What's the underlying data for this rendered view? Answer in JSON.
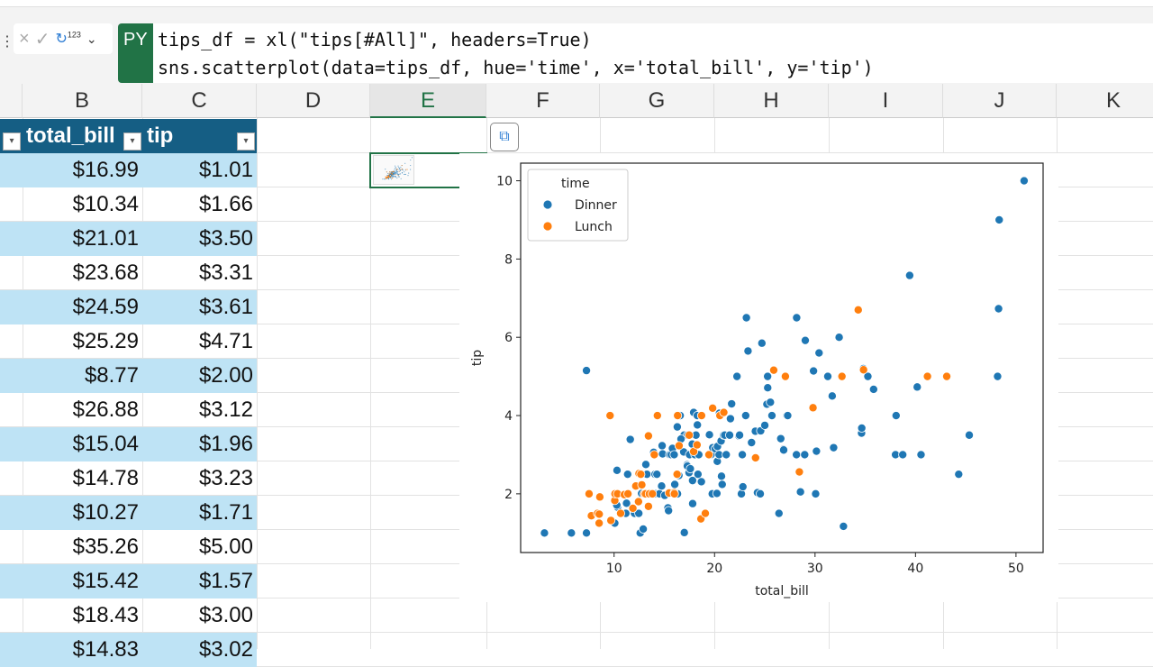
{
  "formula_bar": {
    "cancel_icon": "×",
    "enter_icon": "✓",
    "output_type_label": "123",
    "py_badge": "PY",
    "line1": "tips_df = xl(\"tips[#All]\", headers=True)",
    "line2": "sns.scatterplot(data=tips_df, hue='time', x='total_bill', y='tip')"
  },
  "columns": [
    "B",
    "C",
    "D",
    "E",
    "F",
    "G",
    "H",
    "I",
    "J",
    "K"
  ],
  "table": {
    "headers": [
      "total_bill",
      "tip"
    ],
    "rows": [
      [
        "$16.99",
        "$1.01"
      ],
      [
        "$10.34",
        "$1.66"
      ],
      [
        "$21.01",
        "$3.50"
      ],
      [
        "$23.68",
        "$3.31"
      ],
      [
        "$24.59",
        "$3.61"
      ],
      [
        "$25.29",
        "$4.71"
      ],
      [
        "$8.77",
        "$2.00"
      ],
      [
        "$26.88",
        "$3.12"
      ],
      [
        "$15.04",
        "$1.96"
      ],
      [
        "$14.78",
        "$3.23"
      ],
      [
        "$10.27",
        "$1.71"
      ],
      [
        "$35.26",
        "$5.00"
      ],
      [
        "$15.42",
        "$1.57"
      ],
      [
        "$18.43",
        "$3.00"
      ],
      [
        "$14.83",
        "$3.02"
      ]
    ]
  },
  "chart_data": {
    "type": "scatter",
    "xlabel": "total_bill",
    "ylabel": "tip",
    "xticks": [
      10,
      20,
      30,
      40,
      50
    ],
    "yticks": [
      2,
      4,
      6,
      8,
      10
    ],
    "xlim": [
      0.7,
      52.7
    ],
    "ylim": [
      0.5,
      10.45
    ],
    "legend": {
      "title": "time",
      "placement": "top-left"
    },
    "series": [
      {
        "name": "Dinner",
        "color": "#1f77b4",
        "points": [
          [
            3.07,
            1
          ],
          [
            5.75,
            1
          ],
          [
            7.25,
            1
          ],
          [
            7.25,
            5.15
          ],
          [
            9.55,
            4
          ],
          [
            10.07,
            1.25
          ],
          [
            10.29,
            2.6
          ],
          [
            10.33,
            1.67
          ],
          [
            10.34,
            1.66
          ],
          [
            10.27,
            1.71
          ],
          [
            11.17,
            1.5
          ],
          [
            11.24,
            1.76
          ],
          [
            11.35,
            2.5
          ],
          [
            11.61,
            3.39
          ],
          [
            12.03,
            1.5
          ],
          [
            12.46,
            1.5
          ],
          [
            12.54,
            2.5
          ],
          [
            12.6,
            1
          ],
          [
            12.69,
            2
          ],
          [
            12.74,
            2.01
          ],
          [
            12.9,
            1.1
          ],
          [
            13,
            2
          ],
          [
            13.03,
            2
          ],
          [
            13.16,
            2.75
          ],
          [
            13.27,
            2.5
          ],
          [
            13.37,
            2
          ],
          [
            13.81,
            2
          ],
          [
            13.94,
            3.06
          ],
          [
            14.07,
            2.5
          ],
          [
            14.15,
            2
          ],
          [
            14.26,
            2.5
          ],
          [
            14.31,
            4
          ],
          [
            14.48,
            2
          ],
          [
            14.52,
            2
          ],
          [
            14.73,
            2.2
          ],
          [
            14.78,
            3.23
          ],
          [
            14.83,
            3.02
          ],
          [
            15.04,
            1.96
          ],
          [
            15.36,
            1.64
          ],
          [
            15.42,
            1.57
          ],
          [
            15.53,
            3
          ],
          [
            15.69,
            3
          ],
          [
            15.81,
            3.16
          ],
          [
            15.98,
            3
          ],
          [
            16,
            2
          ],
          [
            16.04,
            2.24
          ],
          [
            16.21,
            2
          ],
          [
            16.29,
            3.71
          ],
          [
            16.31,
            2
          ],
          [
            16.45,
            2.47
          ],
          [
            16.47,
            3.23
          ],
          [
            16.58,
            4
          ],
          [
            16.93,
            3.07
          ],
          [
            16.97,
            3.5
          ],
          [
            16.99,
            1.01
          ],
          [
            17.26,
            2.74
          ],
          [
            17.29,
            2.71
          ],
          [
            17.31,
            3.5
          ],
          [
            17.46,
            2.54
          ],
          [
            17.51,
            3
          ],
          [
            17.59,
            2.64
          ],
          [
            17.78,
            3.27
          ],
          [
            17.81,
            2.34
          ],
          [
            17.82,
            1.75
          ],
          [
            17.92,
            4.08
          ],
          [
            18.04,
            3
          ],
          [
            18.15,
            3.5
          ],
          [
            18.24,
            3.76
          ],
          [
            18.28,
            4
          ],
          [
            18.29,
            3.76
          ],
          [
            18.35,
            2.5
          ],
          [
            18.43,
            3
          ],
          [
            18.69,
            2.31
          ],
          [
            18.71,
            4
          ],
          [
            19.44,
            3
          ],
          [
            19.49,
            3.51
          ],
          [
            19.65,
            3
          ],
          [
            19.77,
            2
          ],
          [
            19.81,
            4.19
          ],
          [
            19.82,
            3.18
          ],
          [
            20.08,
            3.15
          ],
          [
            20.23,
            2.01
          ],
          [
            20.27,
            2.83
          ],
          [
            20.29,
            3.21
          ],
          [
            20.45,
            3
          ],
          [
            20.49,
            4.06
          ],
          [
            20.65,
            3.35
          ],
          [
            20.69,
            2.45
          ],
          [
            20.76,
            2.24
          ],
          [
            20.9,
            3.5
          ],
          [
            21.01,
            3.5
          ],
          [
            21.16,
            3
          ],
          [
            21.5,
            3.5
          ],
          [
            21.58,
            3.92
          ],
          [
            22.23,
            5
          ],
          [
            22.42,
            3.48
          ],
          [
            22.49,
            3.5
          ],
          [
            22.67,
            2
          ],
          [
            22.76,
            3
          ],
          [
            23.1,
            4
          ],
          [
            23.33,
            5.65
          ],
          [
            23.68,
            3.31
          ],
          [
            24.06,
            3.6
          ],
          [
            24.27,
            2.03
          ],
          [
            24.55,
            2
          ],
          [
            24.59,
            3.61
          ],
          [
            25,
            3.75
          ],
          [
            25.21,
            4.29
          ],
          [
            25.28,
            5
          ],
          [
            25.29,
            4.71
          ],
          [
            25.56,
            4.34
          ],
          [
            25.71,
            4
          ],
          [
            25.89,
            5.16
          ],
          [
            26.41,
            1.5
          ],
          [
            26.86,
            3.14
          ],
          [
            26.88,
            3.12
          ],
          [
            27.05,
            5
          ],
          [
            27.2,
            4
          ],
          [
            27.28,
            4
          ],
          [
            28.15,
            3
          ],
          [
            28.44,
            2.56
          ],
          [
            28.55,
            2.05
          ],
          [
            28.97,
            3
          ],
          [
            29.03,
            5.92
          ],
          [
            29.8,
            4.2
          ],
          [
            29.85,
            5.14
          ],
          [
            30.14,
            3.09
          ],
          [
            30.4,
            5.6
          ],
          [
            31.27,
            5
          ],
          [
            31.71,
            4.5
          ],
          [
            32.4,
            6
          ],
          [
            32.68,
            5
          ],
          [
            32.83,
            1.17
          ],
          [
            34.3,
            6.7
          ],
          [
            34.63,
            3.55
          ],
          [
            34.65,
            3.68
          ],
          [
            34.81,
            5.2
          ],
          [
            35.26,
            5
          ],
          [
            35.83,
            4.67
          ],
          [
            38.01,
            3
          ],
          [
            38.07,
            4
          ],
          [
            38.73,
            3
          ],
          [
            39.42,
            7.58
          ],
          [
            40.17,
            4.73
          ],
          [
            40.55,
            3
          ],
          [
            44.3,
            2.5
          ],
          [
            45.35,
            3.5
          ],
          [
            48.17,
            5
          ],
          [
            48.27,
            6.73
          ],
          [
            48.33,
            9
          ],
          [
            50.81,
            10
          ],
          [
            23.17,
            6.5
          ],
          [
            28.17,
            6.5
          ],
          [
            24.71,
            5.85
          ],
          [
            26.59,
            3.41
          ],
          [
            30.06,
            2
          ],
          [
            20.92,
            4.08
          ],
          [
            21.7,
            4.3
          ],
          [
            16.66,
            3.4
          ],
          [
            22.82,
            2.18
          ],
          [
            31.85,
            3.18
          ]
        ]
      },
      {
        "name": "Lunch",
        "color": "#ff7f0e",
        "points": [
          [
            7.51,
            2
          ],
          [
            7.74,
            1.44
          ],
          [
            8.35,
            1.5
          ],
          [
            8.51,
            1.25
          ],
          [
            8.52,
            1.48
          ],
          [
            8.58,
            1.92
          ],
          [
            9.6,
            4
          ],
          [
            9.68,
            1.32
          ],
          [
            10.07,
            1.83
          ],
          [
            10.09,
            2
          ],
          [
            10.34,
            2
          ],
          [
            10.65,
            1.5
          ],
          [
            11.02,
            1.98
          ],
          [
            11.38,
            2
          ],
          [
            11.87,
            1.63
          ],
          [
            12.16,
            2.2
          ],
          [
            12.43,
            1.8
          ],
          [
            12.48,
            2.52
          ],
          [
            12.66,
            2.5
          ],
          [
            12.76,
            2.23
          ],
          [
            13,
            2
          ],
          [
            13.13,
            2
          ],
          [
            13.42,
            3.48
          ],
          [
            13.42,
            1.68
          ],
          [
            13.51,
            2
          ],
          [
            13.81,
            2
          ],
          [
            14,
            3
          ],
          [
            14.31,
            4
          ],
          [
            15.48,
            2.02
          ],
          [
            15.98,
            2.03
          ],
          [
            16,
            2
          ],
          [
            16.27,
            2.5
          ],
          [
            16.32,
            4
          ],
          [
            16.47,
            3.23
          ],
          [
            17.47,
            3.5
          ],
          [
            17.92,
            3.08
          ],
          [
            18.26,
            3.25
          ],
          [
            18.64,
            1.36
          ],
          [
            18.71,
            4
          ],
          [
            19.08,
            1.5
          ],
          [
            19.44,
            3
          ],
          [
            19.81,
            4.19
          ],
          [
            20.53,
            4
          ],
          [
            20.92,
            4.08
          ],
          [
            24.08,
            2.92
          ],
          [
            25.89,
            5.16
          ],
          [
            27.05,
            5
          ],
          [
            28.44,
            2.56
          ],
          [
            29.8,
            4.2
          ],
          [
            32.68,
            5
          ],
          [
            34.3,
            6.7
          ],
          [
            34.83,
            5.17
          ],
          [
            41.19,
            5
          ],
          [
            43.11,
            5
          ]
        ]
      }
    ]
  }
}
